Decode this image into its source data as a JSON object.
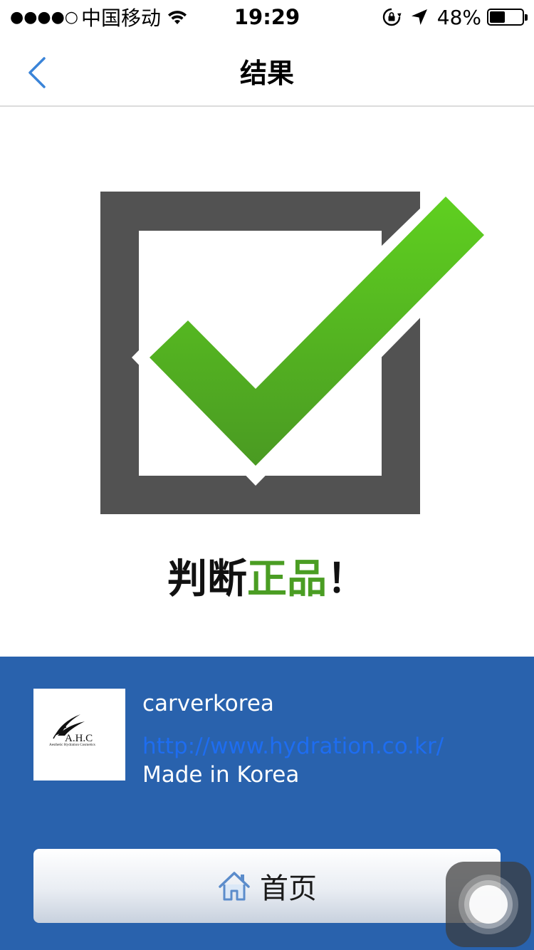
{
  "status_bar": {
    "signal": "●●●●○",
    "carrier": "中国移动",
    "time": "19:29",
    "battery_percent": "48%",
    "battery_level": 0.48
  },
  "nav": {
    "title": "结果",
    "back_icon": "chevron-left-icon"
  },
  "result": {
    "icon": "checkbox-checked-icon",
    "verdict_prefix": "判断",
    "verdict_highlight": "正品",
    "verdict_suffix": "！",
    "highlight_color": "#4a9d23"
  },
  "brand": {
    "logo_text": "A.H.C",
    "logo_subtext": "Aesthetic Hydration Cosmetics",
    "company": "carverkorea",
    "url": "http://www.hydration.co.kr/",
    "origin": "Made in Korea"
  },
  "home_button": {
    "label": "首页",
    "icon": "home-icon"
  },
  "colors": {
    "panel_bg": "#2962ad",
    "link": "#1e6df0",
    "check_green": "#52ad1f",
    "box_gray": "#525252"
  }
}
